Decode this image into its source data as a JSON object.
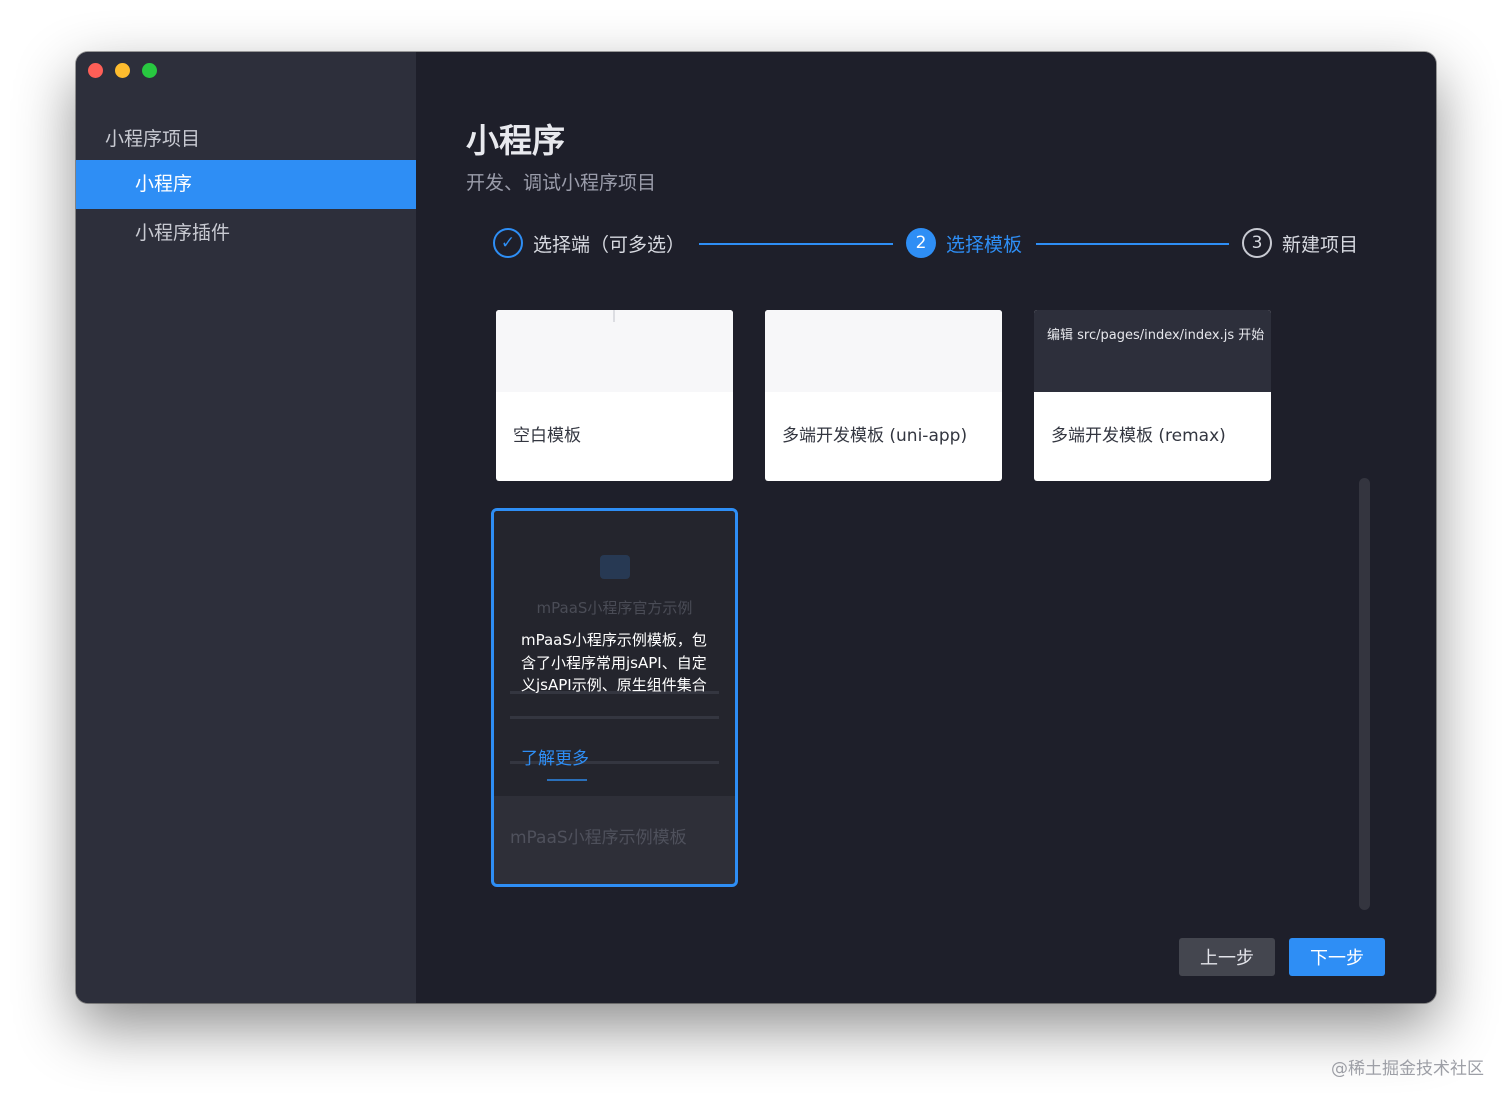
{
  "sidebar": {
    "header": "小程序项目",
    "items": [
      {
        "label": "小程序",
        "active": true
      },
      {
        "label": "小程序插件",
        "active": false
      }
    ]
  },
  "main": {
    "title": "小程序",
    "subtitle": "开发、调试小程序项目"
  },
  "steps": [
    {
      "status": "done",
      "icon": "check-icon",
      "glyph": "✓",
      "label": "选择端（可多选）"
    },
    {
      "status": "current",
      "number": "2",
      "label": "选择模板"
    },
    {
      "status": "todo",
      "number": "3",
      "label": "新建项目"
    }
  ],
  "templates": [
    {
      "label": "空白模板",
      "thumb_caption": ""
    },
    {
      "label": "多端开发模板 (uni-app)",
      "thumb_caption": ""
    },
    {
      "label": "多端开发模板 (remax)",
      "thumb_caption": "编辑 src/pages/index/index.js 开始"
    }
  ],
  "selected_template": {
    "label": "mPaaS小程序示例模板",
    "preview_title": "mPaaS小程序官方示例",
    "description": "mPaaS小程序示例模板，包含了小程序常用jsAPI、自定义jsAPI示例、原生组件集合",
    "learn_more": "了解更多"
  },
  "buttons": {
    "prev": "上一步",
    "next": "下一步"
  },
  "watermark": "@稀土掘金技术社区",
  "colors": {
    "accent": "#2e8ef5",
    "sidebar_bg": "#2d2f3b",
    "main_bg": "#1e1f2a"
  }
}
